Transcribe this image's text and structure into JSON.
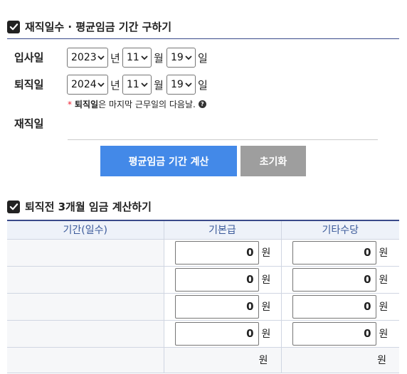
{
  "section1": {
    "title": "재직일수 · 평균임금 기간 구하기",
    "start": {
      "label": "입사일",
      "year": "2023",
      "month": "11",
      "day": "19"
    },
    "end": {
      "label": "퇴직일",
      "year": "2024",
      "month": "11",
      "day": "19"
    },
    "units": {
      "year": "년",
      "month": "월",
      "day": "일"
    },
    "note": {
      "star": "*",
      "bold": "퇴직일",
      "rest": "은 마지막 근무일의 다음날.",
      "help": "?"
    },
    "tenure_label": "재직일",
    "calc_button": "평균임금 기간 계산",
    "reset_button": "초기화"
  },
  "section2": {
    "title": "퇴직전 3개월 임금 계산하기",
    "columns": [
      "기간(일수)",
      "기본급",
      "기타수당"
    ],
    "rows": [
      {
        "period": "",
        "base": "0",
        "extra": "0"
      },
      {
        "period": "",
        "base": "0",
        "extra": "0"
      },
      {
        "period": "",
        "base": "0",
        "extra": "0"
      },
      {
        "period": "",
        "base": "0",
        "extra": "0"
      }
    ],
    "unit": "원",
    "total": {
      "label": "",
      "base_unit": "원",
      "extra_unit": "원"
    }
  }
}
